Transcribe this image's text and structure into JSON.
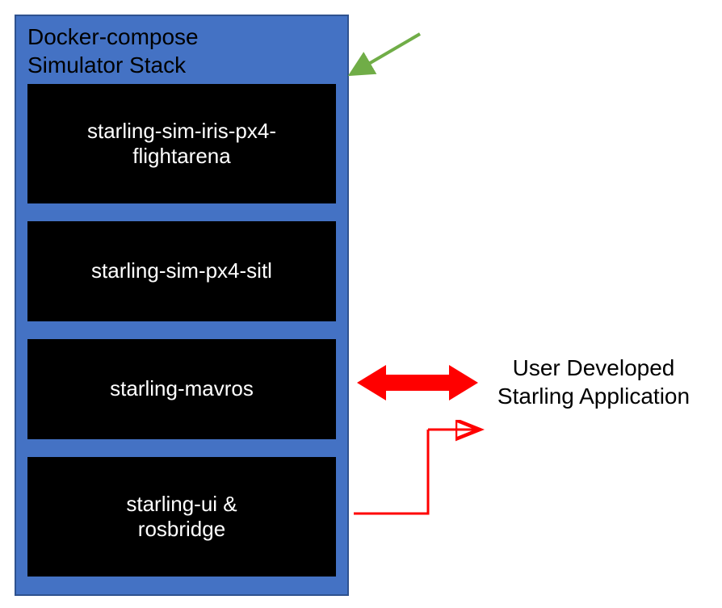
{
  "stack": {
    "title_line1": "Docker-compose",
    "title_line2": "Simulator Stack",
    "boxes": [
      {
        "label_line1": "starling-sim-iris-px4-",
        "label_line2": "flightarena"
      },
      {
        "label_line1": "starling-sim-px4-sitl",
        "label_line2": ""
      },
      {
        "label_line1": "starling-mavros",
        "label_line2": ""
      },
      {
        "label_line1": "starling-ui &",
        "label_line2": "rosbridge"
      }
    ]
  },
  "app_label": {
    "line1": "User Developed",
    "line2": "Starling Application"
  },
  "colors": {
    "stack_bg": "#4472C4",
    "box_bg": "#000000",
    "box_text": "#FFFFFF",
    "green_arrow": "#70AD47",
    "red_arrow": "#FF0000"
  }
}
